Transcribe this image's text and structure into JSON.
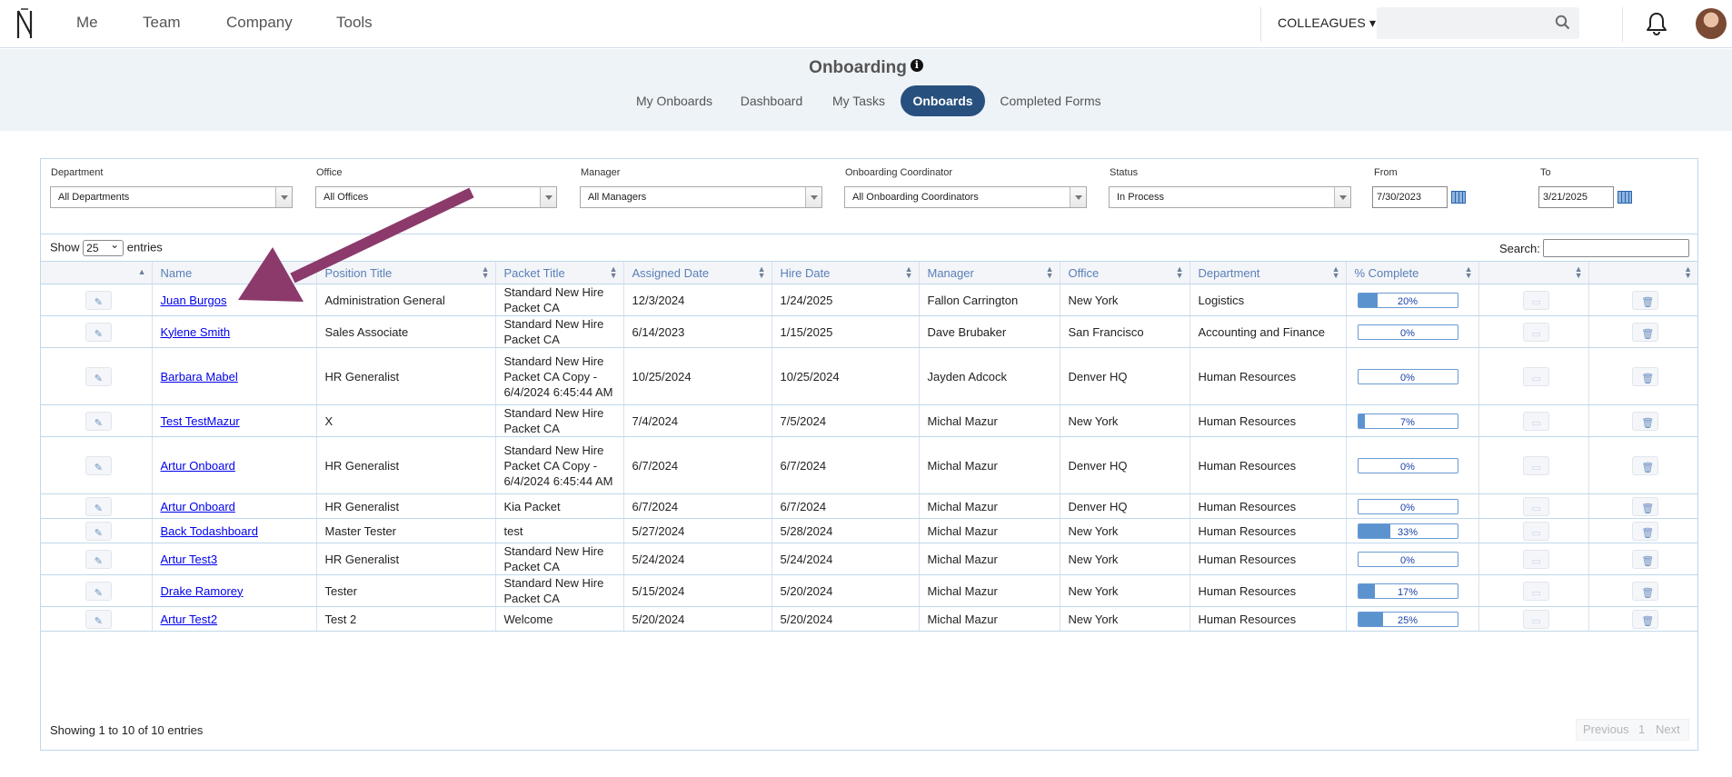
{
  "nav": {
    "me": "Me",
    "team": "Team",
    "company": "Company",
    "tools": "Tools",
    "colleagues": "COLLEAGUES ▾"
  },
  "header": {
    "title": "Onboarding",
    "info": "i",
    "tabs": [
      "My Onboards",
      "Dashboard",
      "My Tasks",
      "Onboards",
      "Completed Forms"
    ],
    "active_tab": "Onboards"
  },
  "filters": {
    "department": {
      "label": "Department",
      "value": "All Departments"
    },
    "office": {
      "label": "Office",
      "value": "All Offices"
    },
    "manager": {
      "label": "Manager",
      "value": "All Managers"
    },
    "coordinator": {
      "label": "Onboarding Coordinator",
      "value": "All Onboarding Coordinators"
    },
    "status": {
      "label": "Status",
      "value": "In Process"
    },
    "from": {
      "label": "From",
      "value": "7/30/2023"
    },
    "to": {
      "label": "To",
      "value": "3/21/2025"
    }
  },
  "table": {
    "show_label": "Show",
    "page_size": "25",
    "entries_label": "entries",
    "search_label": "Search:",
    "columns": [
      "",
      "Name",
      "Position Title",
      "Packet Title",
      "Assigned Date",
      "Hire Date",
      "Manager",
      "Office",
      "Department",
      "% Complete",
      "",
      ""
    ],
    "rows": [
      {
        "name": "Juan Burgos",
        "position": "Administration General",
        "packet": "Standard New Hire Packet CA",
        "assigned": "12/3/2024",
        "hire": "1/24/2025",
        "manager": "Fallon Carrington",
        "office": "New York",
        "department": "Logistics",
        "pct": 20,
        "pct_label": "20%"
      },
      {
        "name": "Kylene Smith",
        "position": "Sales Associate",
        "packet": "Standard New Hire Packet CA",
        "assigned": "6/14/2023",
        "hire": "1/15/2025",
        "manager": "Dave Brubaker",
        "office": "San Francisco",
        "department": "Accounting and Finance",
        "pct": 0,
        "pct_label": "0%"
      },
      {
        "name": "Barbara Mabel",
        "position": "HR Generalist",
        "packet": "Standard New Hire Packet CA Copy - 6/4/2024 6:45:44 AM",
        "assigned": "10/25/2024",
        "hire": "10/25/2024",
        "manager": "Jayden Adcock",
        "office": "Denver HQ",
        "department": "Human Resources",
        "pct": 0,
        "pct_label": "0%"
      },
      {
        "name": "Test TestMazur",
        "position": "X",
        "packet": "Standard New Hire Packet CA",
        "assigned": "7/4/2024",
        "hire": "7/5/2024",
        "manager": "Michal Mazur",
        "office": "New York",
        "department": "Human Resources",
        "pct": 7,
        "pct_label": "7%"
      },
      {
        "name": "Artur Onboard",
        "position": "HR Generalist",
        "packet": "Standard New Hire Packet CA Copy - 6/4/2024 6:45:44 AM",
        "assigned": "6/7/2024",
        "hire": "6/7/2024",
        "manager": "Michal Mazur",
        "office": "Denver HQ",
        "department": "Human Resources",
        "pct": 0,
        "pct_label": "0%"
      },
      {
        "name": "Artur Onboard",
        "position": "HR Generalist",
        "packet": "Kia Packet",
        "assigned": "6/7/2024",
        "hire": "6/7/2024",
        "manager": "Michal Mazur",
        "office": "Denver HQ",
        "department": "Human Resources",
        "pct": 0,
        "pct_label": "0%"
      },
      {
        "name": "Back Todashboard",
        "position": "Master Tester",
        "packet": "test",
        "assigned": "5/27/2024",
        "hire": "5/28/2024",
        "manager": "Michal Mazur",
        "office": "New York",
        "department": "Human Resources",
        "pct": 33,
        "pct_label": "33%"
      },
      {
        "name": "Artur Test3",
        "position": "HR Generalist",
        "packet": "Standard New Hire Packet CA",
        "assigned": "5/24/2024",
        "hire": "5/24/2024",
        "manager": "Michal Mazur",
        "office": "New York",
        "department": "Human Resources",
        "pct": 0,
        "pct_label": "0%"
      },
      {
        "name": "Drake Ramorey",
        "position": "Tester",
        "packet": "Standard New Hire Packet CA",
        "assigned": "5/15/2024",
        "hire": "5/20/2024",
        "manager": "Michal Mazur",
        "office": "New York",
        "department": "Human Resources",
        "pct": 17,
        "pct_label": "17%"
      },
      {
        "name": "Artur Test2",
        "position": "Test 2",
        "packet": "Welcome",
        "assigned": "5/20/2024",
        "hire": "5/20/2024",
        "manager": "Michal Mazur",
        "office": "New York",
        "department": "Human Resources",
        "pct": 25,
        "pct_label": "25%"
      }
    ],
    "info": "Showing 1 to 10 of 10 entries",
    "pager": {
      "previous": "Previous",
      "page": "1",
      "next": "Next"
    }
  },
  "colors": {
    "accent": "#28507e",
    "link": "#0000ee",
    "progress": "#5b93cf",
    "arrow": "#8b3a6b"
  }
}
